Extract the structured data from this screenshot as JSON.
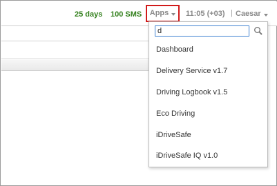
{
  "header": {
    "days_label": "25 days",
    "sms_label": "100 SMS",
    "apps_label": "Apps",
    "time_label": "11:05 (+03)",
    "separator": "|",
    "user_label": "Caesar"
  },
  "apps_dropdown": {
    "search_value": "d",
    "items": [
      {
        "label": "Dashboard"
      },
      {
        "label": "Delivery Service v1.7"
      },
      {
        "label": "Driving Logbook v1.5"
      },
      {
        "label": "Eco Driving"
      },
      {
        "label": "iDriveSafe"
      },
      {
        "label": "iDriveSafe IQ v1.0"
      }
    ]
  },
  "colors": {
    "status_green": "#2e7d17",
    "highlight_red": "#d11a1a",
    "input_focus_blue": "#3b7fd0",
    "muted_text": "#8a8a8a"
  },
  "icons": {
    "search": "search-icon",
    "caret": "chevron-down-icon"
  }
}
